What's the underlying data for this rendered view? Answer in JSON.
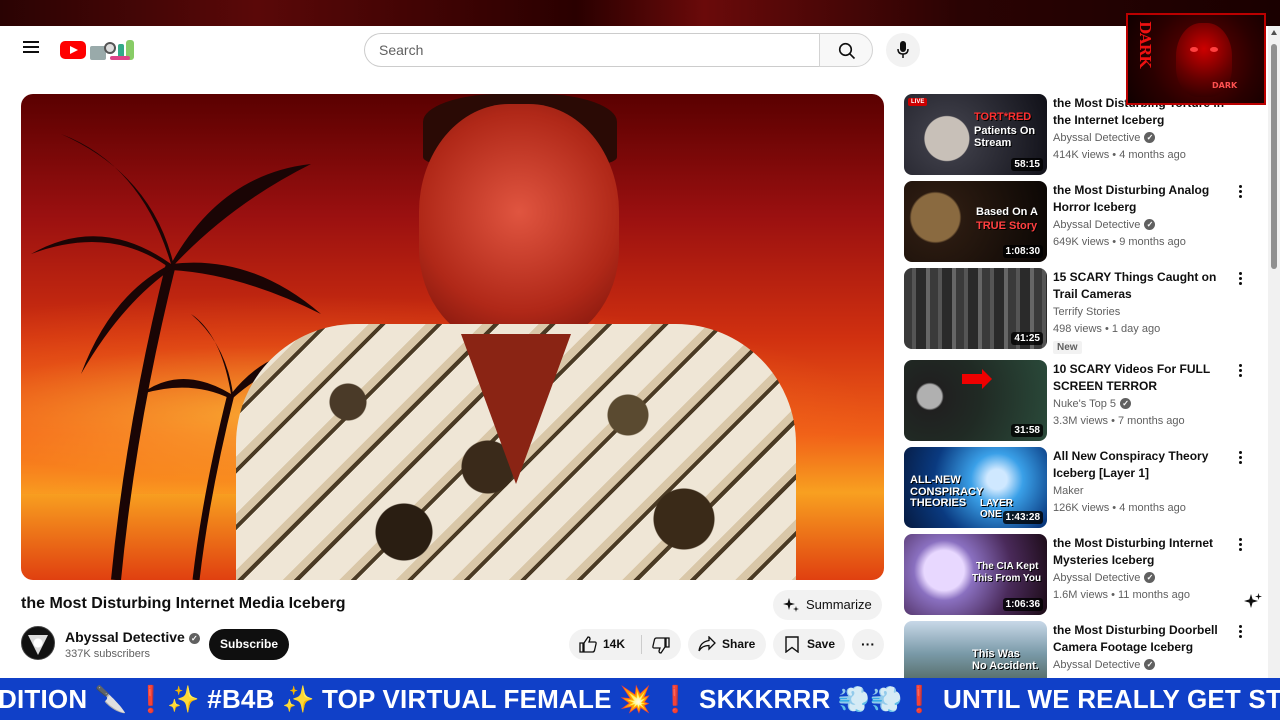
{
  "masthead": {
    "search_placeholder": "Search",
    "icons": [
      "menu-icon",
      "youtube-logo",
      "search-icon",
      "microphone-icon"
    ]
  },
  "overlay": {
    "letters": "DARK",
    "tag": "DARK"
  },
  "video": {
    "title": "the Most Disturbing Internet Media Iceberg",
    "summarize_label": "Summarize",
    "channel_name": "Abyssal Detective",
    "subscribers": "337K subscribers",
    "subscribe_label": "Subscribe",
    "likes": "14K",
    "share_label": "Share",
    "save_label": "Save",
    "more_label": "···"
  },
  "recommendations": [
    {
      "title": "the Most Disturbing Torture in the Internet Iceberg",
      "channel": "Abyssal Detective",
      "verified": true,
      "meta": "414K views • 4 months ago",
      "duration": "58:15",
      "badge": "",
      "live_tag": "LIVE",
      "thumb_text_1": "TORT*RED",
      "thumb_text_2": "Patients On Stream"
    },
    {
      "title": "the Most Disturbing Analog Horror Iceberg",
      "channel": "Abyssal Detective",
      "verified": true,
      "meta": "649K views • 9 months ago",
      "duration": "1:08:30",
      "badge": "",
      "thumb_text_1": "Based On A",
      "thumb_text_2": "TRUE Story"
    },
    {
      "title": "15 SCARY Things Caught on Trail Cameras",
      "channel": "Terrify Stories",
      "verified": false,
      "meta": "498 views • 1 day ago",
      "duration": "41:25",
      "badge": "New"
    },
    {
      "title": "10 SCARY Videos For FULL SCREEN TERROR",
      "channel": "Nuke's Top 5",
      "verified": true,
      "meta": "3.3M views • 7 months ago",
      "duration": "31:58",
      "badge": ""
    },
    {
      "title": "All New Conspiracy Theory Iceberg [Layer 1]",
      "channel": "Maker",
      "verified": false,
      "meta": "126K views • 4 months ago",
      "duration": "1:43:28",
      "badge": "",
      "thumb_text_1": "ALL-NEW CONSPIRACY THEORIES",
      "thumb_text_2": "LAYER ONE"
    },
    {
      "title": "the Most Disturbing Internet Mysteries Iceberg",
      "channel": "Abyssal Detective",
      "verified": true,
      "meta": "1.6M views • 11 months ago",
      "duration": "1:06:36",
      "badge": "",
      "thumb_text_1": "The CIA Kept",
      "thumb_text_2": "This From You"
    },
    {
      "title": "the Most Disturbing Doorbell Camera Footage Iceberg",
      "channel": "Abyssal Detective",
      "verified": true,
      "meta": "",
      "duration": "",
      "badge": "",
      "thumb_text_1": "This Was",
      "thumb_text_2": "No Accident."
    }
  ],
  "ticker": {
    "text": "DITION 🔪 ❗✨ #B4B ✨ TOP VIRTUAL FEMALE 💥 ❗ SKKKRRR 💨💨❗ UNTIL WE REALLY GET STARTED"
  },
  "colors": {
    "brand_red": "#ff0000",
    "ticker_blue": "#1040c8",
    "text_primary": "#0f0f0f",
    "text_secondary": "#606060"
  }
}
